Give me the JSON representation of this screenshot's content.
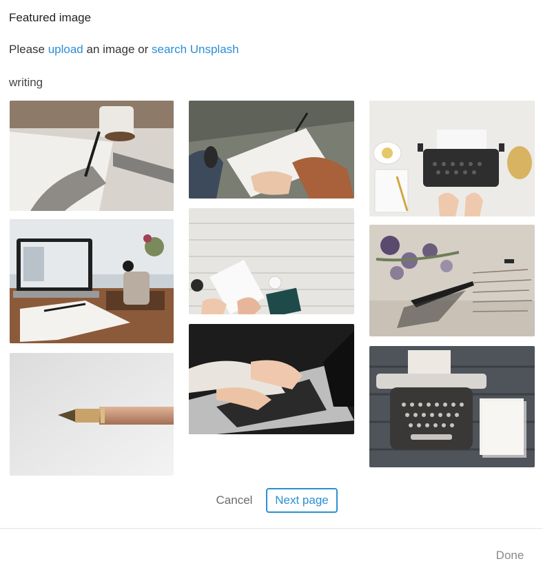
{
  "header": {
    "title": "Featured image"
  },
  "prompt": {
    "prefix": "Please ",
    "upload_link": "upload",
    "middle": " an image or ",
    "search_link": "search Unsplash"
  },
  "search": {
    "query": "writing"
  },
  "results": [
    {
      "name": "photo-hand-writing-notebook-coffee"
    },
    {
      "name": "photo-laptop-notebook-desk"
    },
    {
      "name": "photo-fountain-pen"
    },
    {
      "name": "photo-writing-notebook-lap"
    },
    {
      "name": "photo-white-wood-table-writing"
    },
    {
      "name": "photo-hands-typing-laptop"
    },
    {
      "name": "photo-typewriter-top-view"
    },
    {
      "name": "photo-flowers-pen-letter"
    },
    {
      "name": "photo-typewriter-dark-wood"
    }
  ],
  "pagination": {
    "cancel_label": "Cancel",
    "next_label": "Next page"
  },
  "footer": {
    "done_label": "Done"
  },
  "colors": {
    "accent": "#2a8fd4",
    "muted": "#8a8a8a"
  }
}
